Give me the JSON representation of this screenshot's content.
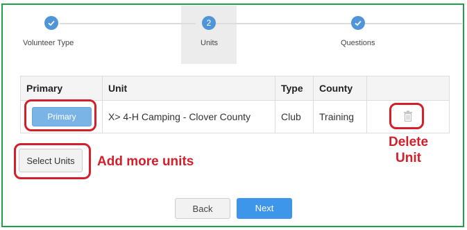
{
  "stepper": {
    "steps": [
      {
        "label": "Volunteer Type",
        "marker": "check-icon",
        "state": "complete"
      },
      {
        "label": "Units",
        "marker": "2",
        "state": "active"
      },
      {
        "label": "Questions",
        "marker": "check-icon",
        "state": "complete"
      }
    ]
  },
  "table": {
    "headers": [
      "Primary",
      "Unit",
      "Type",
      "County",
      ""
    ],
    "rows": [
      {
        "primary_label": "Primary",
        "unit": "X> 4-H Camping - Clover County",
        "type": "Club",
        "county": "Training",
        "action": "trash-icon"
      }
    ]
  },
  "buttons": {
    "select_units": "Select Units",
    "back": "Back",
    "next": "Next"
  },
  "annotations": {
    "add_more": "Add more units",
    "delete_line1": "Delete",
    "delete_line2": "Unit"
  },
  "colors": {
    "frame": "#1fa14a",
    "accent": "#3d96ea",
    "annotation": "#d21f2a"
  }
}
